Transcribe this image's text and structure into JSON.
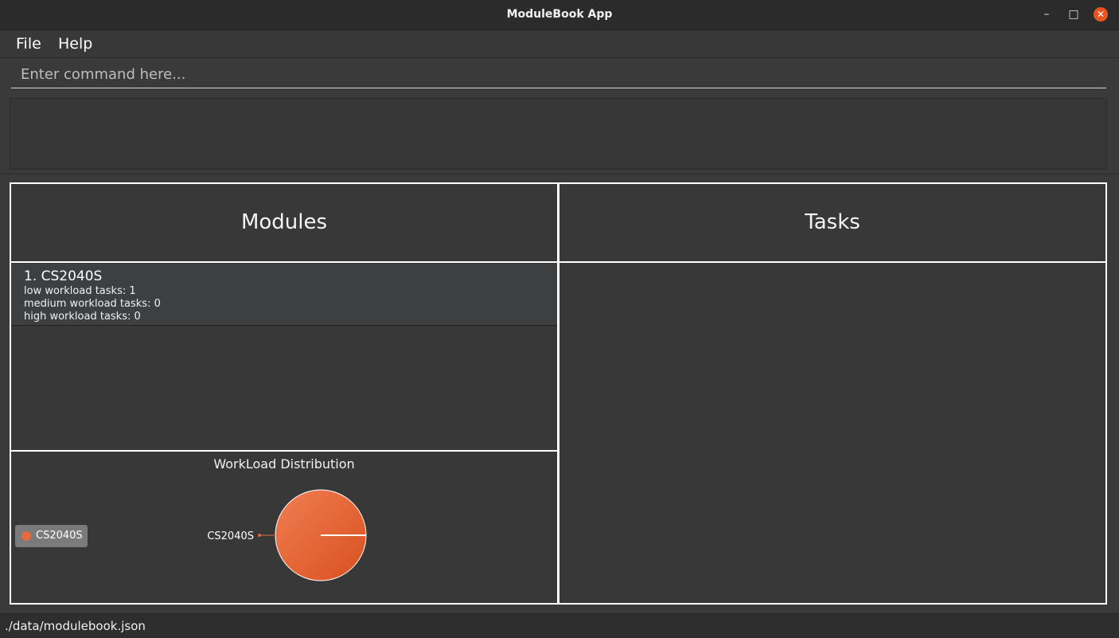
{
  "window": {
    "title": "ModuleBook App",
    "minimize": "–",
    "maximize": "□",
    "close": "✕"
  },
  "menu": {
    "file": "File",
    "help": "Help"
  },
  "command": {
    "placeholder": "Enter command here..."
  },
  "result": {
    "text": ""
  },
  "modules_panel": {
    "title": "Modules",
    "items": [
      {
        "label": "1.  CS2040S",
        "low": "low workload tasks: 1",
        "medium": "medium workload tasks: 0",
        "high": "high workload tasks: 0"
      }
    ]
  },
  "tasks_panel": {
    "title": "Tasks"
  },
  "chart_data": {
    "type": "pie",
    "title": "WorkLoad Distribution",
    "slices": [
      {
        "label": "CS2040S",
        "value": 1,
        "color": "#e46a3c"
      }
    ],
    "legend": [
      "CS2040S"
    ],
    "legend_position": "left"
  },
  "status": {
    "path": "./data/modulebook.json"
  }
}
